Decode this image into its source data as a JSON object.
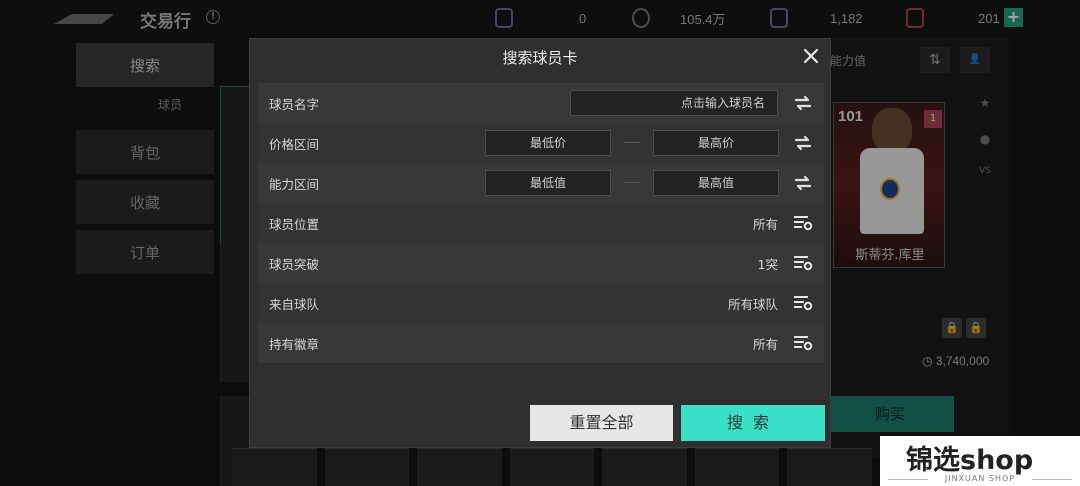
{
  "topbar": {
    "title": "交易行",
    "currencies": [
      "0",
      "105.4万",
      "1,182",
      "201"
    ]
  },
  "sidebar": {
    "items": [
      {
        "label": "搜索"
      },
      {
        "label": "背包"
      },
      {
        "label": "收藏"
      },
      {
        "label": "订单"
      }
    ],
    "sub_label": "球员"
  },
  "right_panel": {
    "sort_label": "能力值",
    "player_rating": "101",
    "player_name": "斯蒂芬.库里",
    "price": "3,740,000",
    "buy_label": "购买"
  },
  "modal": {
    "title": "搜索球员卡",
    "name_row": {
      "label": "球员名字",
      "placeholder": "点击输入球员名"
    },
    "price_row": {
      "label": "价格区间",
      "min": "最低价",
      "max": "最高价"
    },
    "ability_row": {
      "label": "能力区间",
      "min": "最低值",
      "max": "最高值"
    },
    "position_row": {
      "label": "球员位置",
      "value": "所有"
    },
    "breakthrough_row": {
      "label": "球员突破",
      "value": "1突"
    },
    "team_row": {
      "label": "来自球队",
      "value": "所有球队"
    },
    "badge_row": {
      "label": "持有徽章",
      "value": "所有"
    },
    "reset_label": "重置全部",
    "search_label": "搜索"
  },
  "watermark": {
    "main": "锦选shop",
    "sub": "JINXUAN SHOP"
  },
  "colors": {
    "accent": "#39e0c6",
    "modal_bg": "#2f2f2f",
    "buy": "#1f7a68"
  }
}
